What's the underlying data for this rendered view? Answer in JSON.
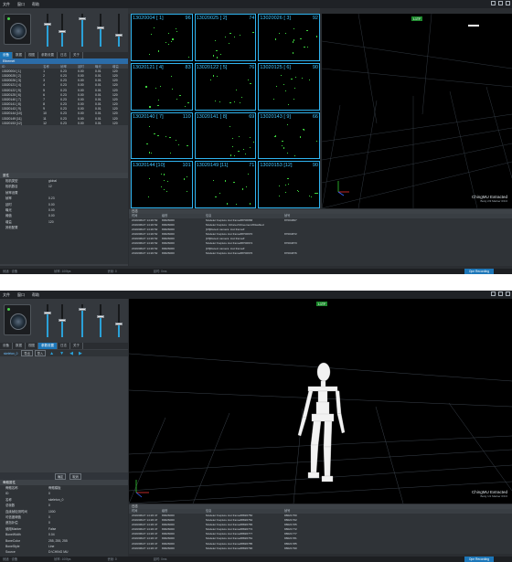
{
  "menu": [
    "文件",
    "窗口",
    "帮助"
  ],
  "shot1": {
    "tabs": [
      "设备",
      "数据",
      "视图",
      "参数设置",
      "日志",
      "关于"
    ],
    "device_header": "Ethernet",
    "table_header": [
      "ID",
      "名称",
      "帧率",
      "延时",
      "曝光",
      "增益"
    ],
    "table_rows": [
      [
        "13020004 [ 1]",
        "1",
        "0.23",
        "0.00",
        "0.01",
        "120"
      ],
      [
        "13020025 [ 2]",
        "2",
        "0.23",
        "0.00",
        "0.01",
        "120"
      ],
      [
        "13020026 [ 3]",
        "3",
        "0.23",
        "0.00",
        "0.01",
        "120"
      ],
      [
        "13020121 [ 4]",
        "4",
        "0.23",
        "0.00",
        "0.01",
        "120"
      ],
      [
        "13020122 [ 5]",
        "5",
        "0.23",
        "0.00",
        "0.01",
        "120"
      ],
      [
        "13020125 [ 6]",
        "6",
        "0.23",
        "0.00",
        "0.01",
        "120"
      ],
      [
        "13020140 [ 7]",
        "7",
        "0.23",
        "0.00",
        "0.01",
        "120"
      ],
      [
        "13020141 [ 8]",
        "8",
        "0.23",
        "0.00",
        "0.01",
        "120"
      ],
      [
        "13020143 [ 9]",
        "9",
        "0.23",
        "0.00",
        "0.01",
        "120"
      ],
      [
        "13020144 [10]",
        "10",
        "0.23",
        "0.00",
        "0.01",
        "120"
      ],
      [
        "13020149 [11]",
        "11",
        "0.23",
        "0.00",
        "0.01",
        "120"
      ],
      [
        "13020153 [12]",
        "12",
        "0.23",
        "0.00",
        "0.01",
        "120"
      ]
    ],
    "props_title": "属性",
    "props": [
      [
        "相机类型",
        "global"
      ],
      [
        "相机数目",
        "12"
      ],
      [
        "帧率设置",
        ""
      ],
      [
        "  帧率",
        "0.23"
      ],
      [
        "  延时",
        "0.00"
      ],
      [
        "  曝光",
        "0.00"
      ],
      [
        "  阈值",
        "0.00"
      ],
      [
        "  增益",
        "120"
      ],
      [
        "其他配置",
        ""
      ]
    ],
    "cameras": [
      {
        "label": "13020004 [ 1]",
        "num": "96"
      },
      {
        "label": "13020025 [ 2]",
        "num": "74"
      },
      {
        "label": "13020026 [ 3]",
        "num": "92"
      },
      {
        "label": "13020121 [ 4]",
        "num": "83"
      },
      {
        "label": "13020122 [ 5]",
        "num": "76"
      },
      {
        "label": "13020125 [ 6]",
        "num": "90"
      },
      {
        "label": "13020140 [ 7]",
        "num": "110"
      },
      {
        "label": "13020141 [ 8]",
        "num": "69"
      },
      {
        "label": "13020143 [ 9]",
        "num": "66"
      },
      {
        "label": "13020144 [10]",
        "num": "101"
      },
      {
        "label": "13020149 [11]",
        "num": "71"
      },
      {
        "label": "13020153 [12]",
        "num": "90"
      }
    ],
    "badge": "L1TF",
    "brand": "ChingMU Extracted",
    "brand_sub": "Body 2/3 Marker 0/0.0",
    "log_title": "日志",
    "log_header": [
      "时间",
      "级别",
      "信息",
      "帧号"
    ],
    "log_lines": [
      [
        "2019/06/27 14:20:52",
        "80026000",
        "Modeler:Capture lost frame#8700658",
        "87004807"
      ],
      [
        "2019/06/27 14:20:52",
        "80026000",
        "Modeler:Capture: Infrared Movement/Disabled",
        ""
      ],
      [
        "2019/06/27 14:20:52",
        "80026000",
        "[15]Detect camera: lost frame#",
        ""
      ],
      [
        "2019/06/27 14:20:52",
        "80026000",
        "Modeler:Capture lost frame#8700670",
        "87004872"
      ],
      [
        "2019/06/27 14:20:52",
        "80026000",
        "[15]Detect camera: lost frame#",
        ""
      ],
      [
        "2019/06/27 14:20:52",
        "80026000",
        "Modeler:Capture lost frame#8700674",
        "87004873"
      ],
      [
        "2019/06/27 14:20:52",
        "80026000",
        "[15]Detect camera: lost frame#",
        ""
      ],
      [
        "2019/06/27 14:20:52",
        "80026000",
        "Modeler:Capture lost frame#8700676",
        "87004876"
      ]
    ],
    "status": [
      "就绪 · 设备",
      "帧率: 100fps",
      "丢帧: 0",
      "延时: 0ms"
    ],
    "status_right": "Ope Recording"
  },
  "shot2": {
    "tabs": [
      "设备",
      "数据",
      "视图",
      "参数设置",
      "日志",
      "关于"
    ],
    "tree_item": "skeleton_0",
    "toolbar": [
      "导出",
      "导入"
    ],
    "props_title": "骨骼属性",
    "props": [
      [
        "骨骼名称",
        "骨骼模板"
      ],
      [
        "ID",
        "0"
      ],
      [
        "名称",
        "skeleton_0"
      ],
      [
        "总帧数",
        "0"
      ],
      [
        "连续帧检测时间",
        "1000"
      ],
      [
        "可信度阈值",
        "0"
      ],
      [
        "遮挡补偿",
        "0"
      ],
      [
        "使用Marker",
        "False"
      ],
      [
        "BoneWidth",
        "0.04"
      ],
      [
        "BoneColor",
        "255, 255, 255"
      ],
      [
        "BoneStyle",
        "Line"
      ],
      [
        "Source",
        "D:\\CHING MU"
      ],
      [
        "ShowSetting",
        "True"
      ],
      [
        "锁定显示",
        "False"
      ]
    ],
    "side_buttons": [
      "确定",
      "取消"
    ],
    "badge": "L1TF",
    "brand": "ChingMU Extracted",
    "brand_sub": "Body 1/1 Marker 0/0.0",
    "log_title": "日志",
    "log_header": [
      "时间",
      "级别",
      "信息",
      "帧号"
    ],
    "log_lines": [
      [
        "2019/06/27 14:26:47",
        "80026000",
        "Modeler:Capture lost frame#8820750",
        "88021750"
      ],
      [
        "2019/06/27 14:26:47",
        "80026000",
        "Modeler:Capture lost frame#8820762",
        "88021762"
      ],
      [
        "2019/06/27 14:26:47",
        "80026000",
        "Modeler:Capture lost frame#8820765",
        "88021765"
      ],
      [
        "2019/06/27 14:26:47",
        "80026000",
        "Modeler:Capture lost frame#8820772",
        "88021772"
      ],
      [
        "2019/06/27 14:26:47",
        "80026000",
        "Modeler:Capture lost frame#8820777",
        "88021777"
      ],
      [
        "2019/06/27 14:26:47",
        "80026000",
        "Modeler:Capture lost frame#8820781",
        "88021781"
      ],
      [
        "2019/06/27 14:26:47",
        "80026000",
        "Modeler:Capture lost frame#8820785",
        "88021785"
      ],
      [
        "2019/06/27 14:26:47",
        "80026000",
        "Modeler:Capture lost frame#8820790",
        "88021790"
      ]
    ],
    "status": [
      "就绪 · 设备",
      "帧率: 100fps",
      "丢帧: 0",
      "延时: 0ms"
    ],
    "status_right": "Ope Recording"
  }
}
